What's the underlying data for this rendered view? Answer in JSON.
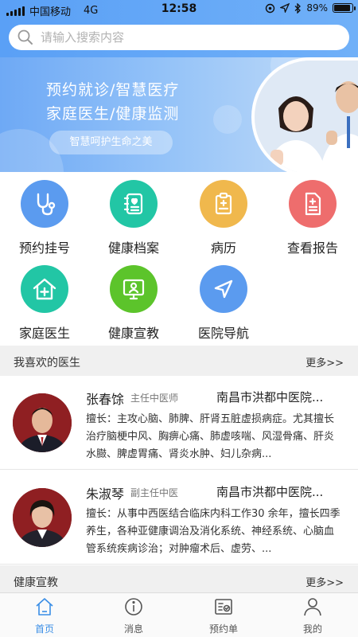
{
  "status_bar": {
    "carrier": "中国移动",
    "network": "4G",
    "time": "12:58",
    "battery": "89%"
  },
  "search": {
    "placeholder": "请输入搜索内容"
  },
  "banner": {
    "line1": "预约就诊/智慧医疗",
    "line2": "家庭医生/健康监测",
    "slogan": "智慧呵护生命之美"
  },
  "grid": {
    "items": [
      {
        "label": "预约挂号",
        "icon": "stethoscope-icon",
        "color": "#5b9bef"
      },
      {
        "label": "健康档案",
        "icon": "health-record-icon",
        "color": "#22c6a5"
      },
      {
        "label": "病历",
        "icon": "clipboard-icon",
        "color": "#f0b84d"
      },
      {
        "label": "查看报告",
        "icon": "report-icon",
        "color": "#ee6d6d"
      },
      {
        "label": "家庭医生",
        "icon": "home-plus-icon",
        "color": "#22c6a5"
      },
      {
        "label": "健康宣教",
        "icon": "monitor-person-icon",
        "color": "#5cc42b"
      },
      {
        "label": "医院导航",
        "icon": "navigation-icon",
        "color": "#5b9bef"
      }
    ]
  },
  "favorites": {
    "title": "我喜欢的医生",
    "more": "更多>>"
  },
  "doctors": [
    {
      "name": "张春馀",
      "title": "主任中医师",
      "hospital": "南昌市洪都中医院...",
      "desc": "擅长：主攻心脑、肺脾、肝肾五脏虚损病症。尤其擅长治疗脑梗中风、胸痹心痛、肺虚咳喘、风湿骨痛、肝炎水臌、脾虚胃痛、肾炎水肿、妇儿杂病..."
    },
    {
      "name": "朱淑琴",
      "title": "副主任中医",
      "hospital": "南昌市洪都中医院...",
      "desc": "擅长：从事中西医结合临床内科工作30 余年，擅长四季养生，各种亚健康调治及消化系统、神经系统、心脑血管系统疾病诊治；对肿瘤术后、虚劳、..."
    }
  ],
  "education": {
    "title": "健康宣教",
    "more": "更多>>"
  },
  "tabbar": {
    "items": [
      {
        "label": "首页",
        "icon": "home-icon",
        "active": true
      },
      {
        "label": "消息",
        "icon": "info-icon",
        "active": false
      },
      {
        "label": "预约单",
        "icon": "appointment-icon",
        "active": false
      },
      {
        "label": "我的",
        "icon": "user-icon",
        "active": false
      }
    ]
  },
  "colors": {
    "accent": "#3a8ee6",
    "header": "#5aa0f6"
  }
}
